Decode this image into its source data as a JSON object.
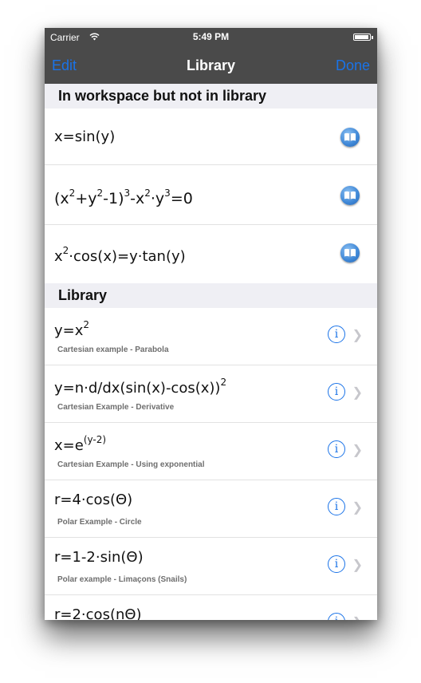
{
  "status": {
    "carrier": "Carrier",
    "time": "5:49 PM",
    "battery_level": 0.95
  },
  "nav": {
    "title": "Library",
    "edit_label": "Edit",
    "done_label": "Done"
  },
  "workspace_section": {
    "header": "In workspace but not in library"
  },
  "library_section": {
    "header": "Library"
  },
  "icons": {
    "add_to_library": "book-icon",
    "info": "info-icon",
    "disclosure": "chevron-right-icon",
    "wifi": "wifi-icon",
    "battery": "battery-icon"
  },
  "colors": {
    "accent": "#1a73e8",
    "navbar": "#4a4a4a",
    "section_bg": "#efeff4"
  },
  "ws": {
    "f1": {
      "lhs": "x=sin(y)"
    },
    "f2": {
      "p1": "(x",
      "e1": "2",
      "p2": "+y",
      "e2": "2",
      "p3": "-1)",
      "e3": "3",
      "p4": "-x",
      "e4": "2",
      "p5": "·y",
      "e5": "3",
      "p6": "=0"
    },
    "f3": {
      "p1": "x",
      "e1": "2",
      "p2": "·cos(x)=y·tan(y)"
    }
  },
  "lib": {
    "r1": {
      "p1": "y=x",
      "e1": "2",
      "desc": "Cartesian example - Parabola"
    },
    "r2": {
      "p1": "y=n·d/dx(sin(x)-cos(x))",
      "e1": "2",
      "desc": "Cartesian Example - Derivative"
    },
    "r3": {
      "p1": "x=e",
      "e1": "(y-2)",
      "desc": "Cartesian Example - Using exponential"
    },
    "r4": {
      "p1": "r=4·cos(Θ)",
      "desc": "Polar Example - Circle"
    },
    "r5": {
      "p1": "r=1-2·sin(Θ)",
      "desc": "Polar example - Limaçons (Snails)"
    },
    "r6": {
      "p1": "r=2·cos(nΘ)",
      "desc": ""
    }
  }
}
